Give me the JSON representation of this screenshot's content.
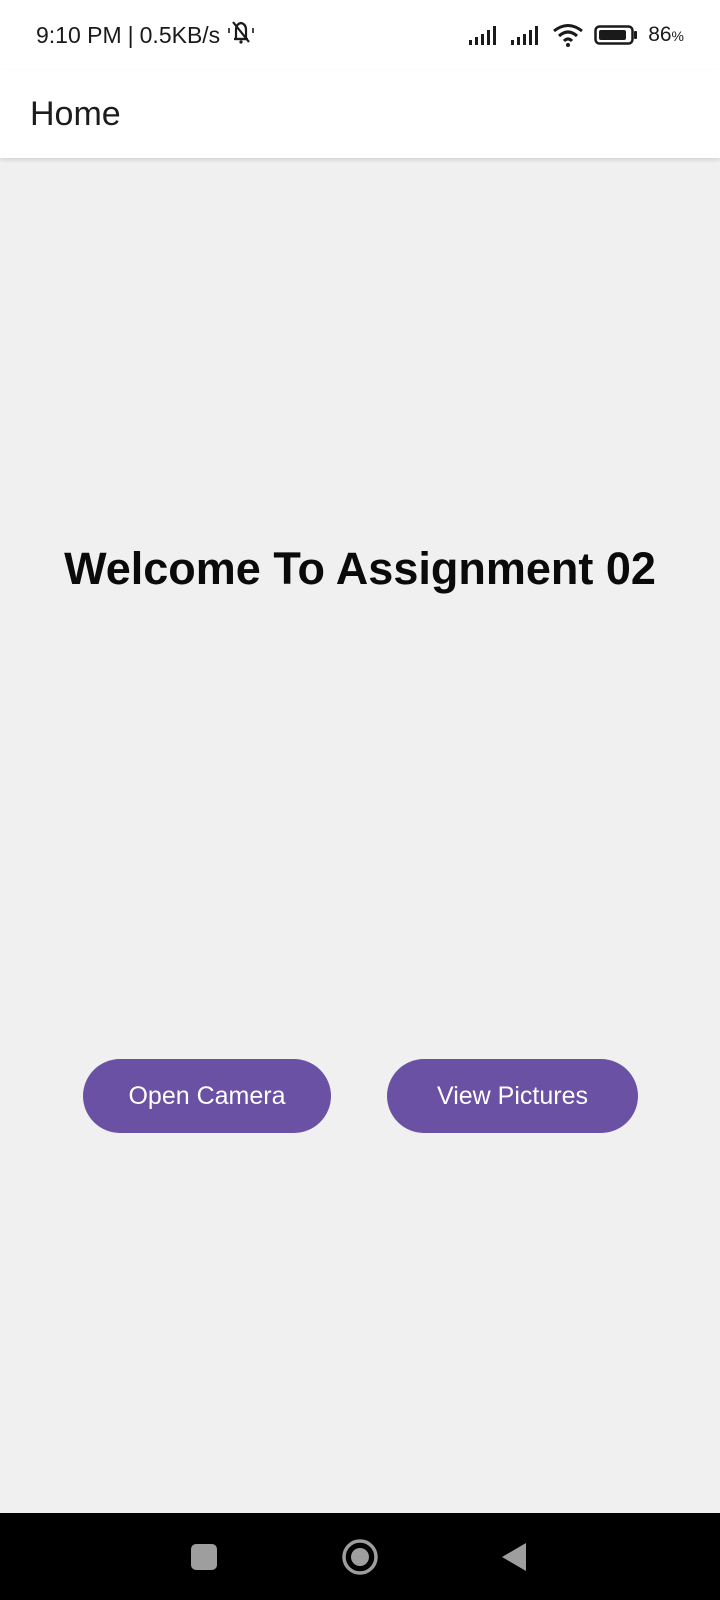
{
  "status_bar": {
    "time": "9:10 PM",
    "separator": "|",
    "net_speed": "0.5KB/s",
    "battery_level": "86",
    "battery_unit": "%",
    "icons": [
      "mute-bell-icon",
      "signal-icon",
      "signal-icon",
      "wifi-icon",
      "battery-icon"
    ]
  },
  "app_bar": {
    "title": "Home"
  },
  "main": {
    "welcome_text": "Welcome To Assignment 02",
    "buttons": {
      "open_camera": "Open Camera",
      "view_pictures": "View Pictures"
    }
  },
  "nav_bar": {
    "icons": [
      "recents-icon",
      "home-icon",
      "back-icon"
    ]
  },
  "colors": {
    "accent": "#6a51a3",
    "background": "#f0f0f1",
    "app_bar": "#ffffff",
    "nav_bar": "#000000"
  }
}
